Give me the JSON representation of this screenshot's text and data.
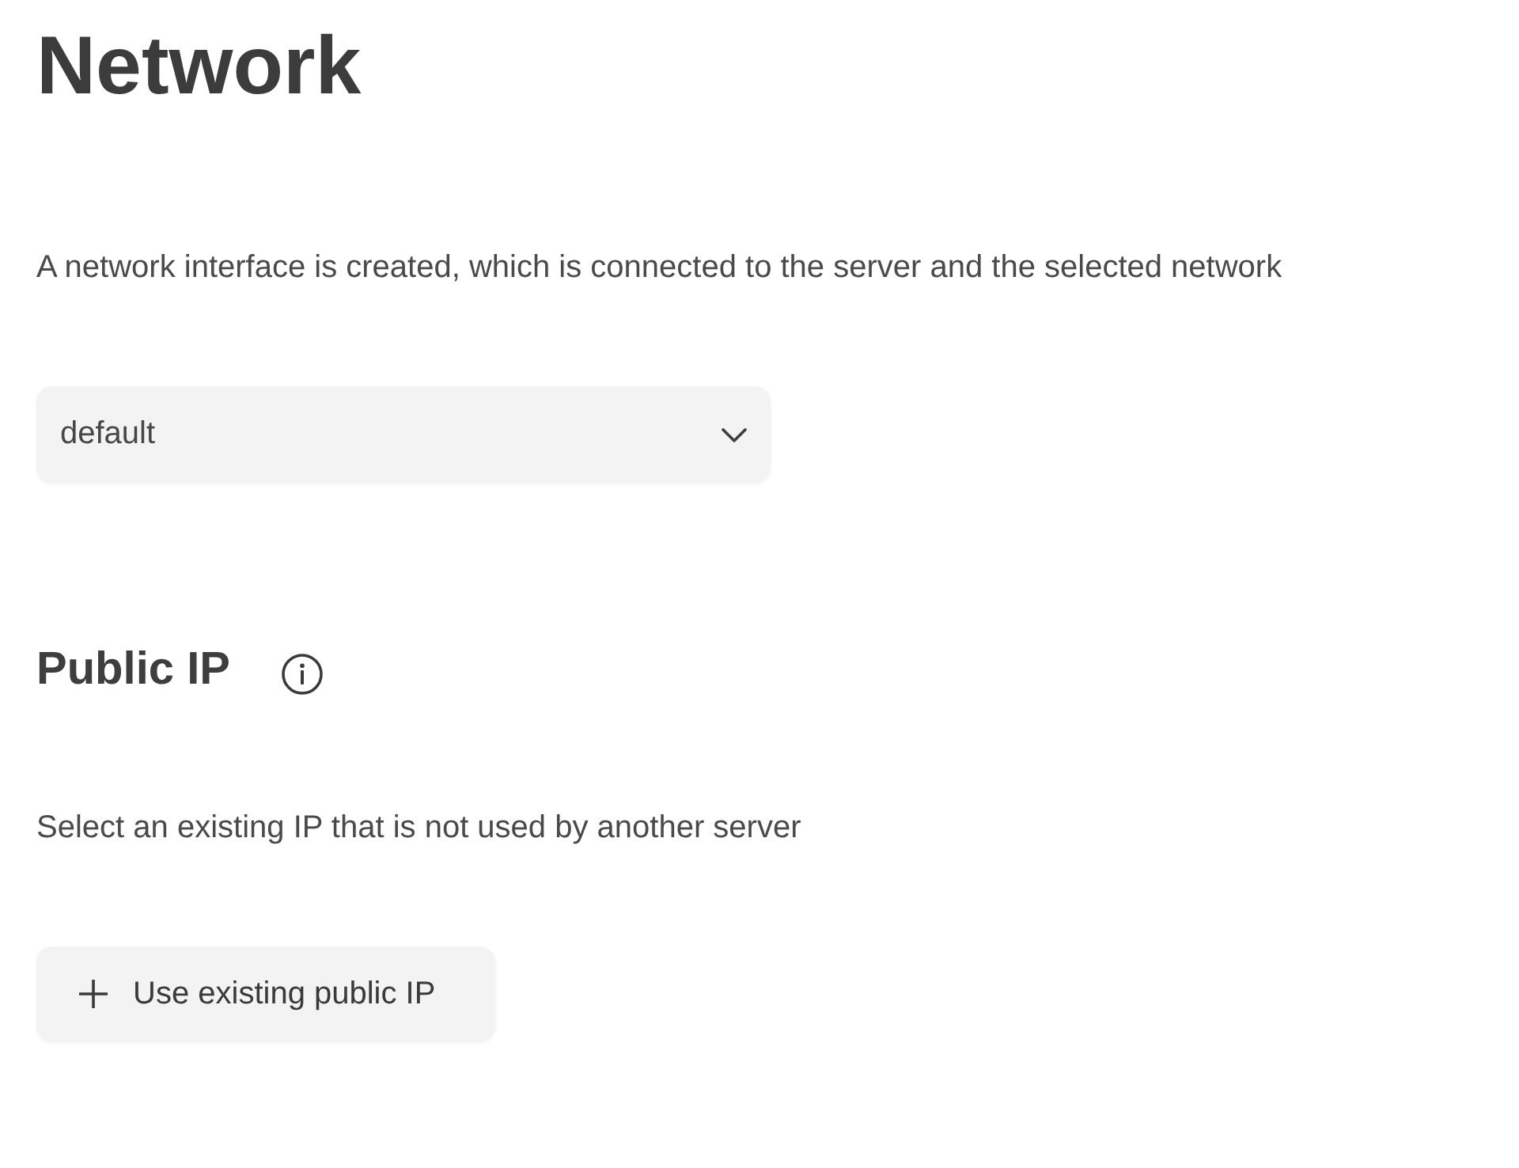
{
  "title": "Network",
  "network_section": {
    "description": "A network interface is created, which is connected to the server and the selected network",
    "select": {
      "value": "default"
    }
  },
  "public_ip_section": {
    "heading": "Public IP",
    "description": "Select an existing IP that is not used by another server",
    "button": {
      "label": "Use existing public IP"
    }
  }
}
